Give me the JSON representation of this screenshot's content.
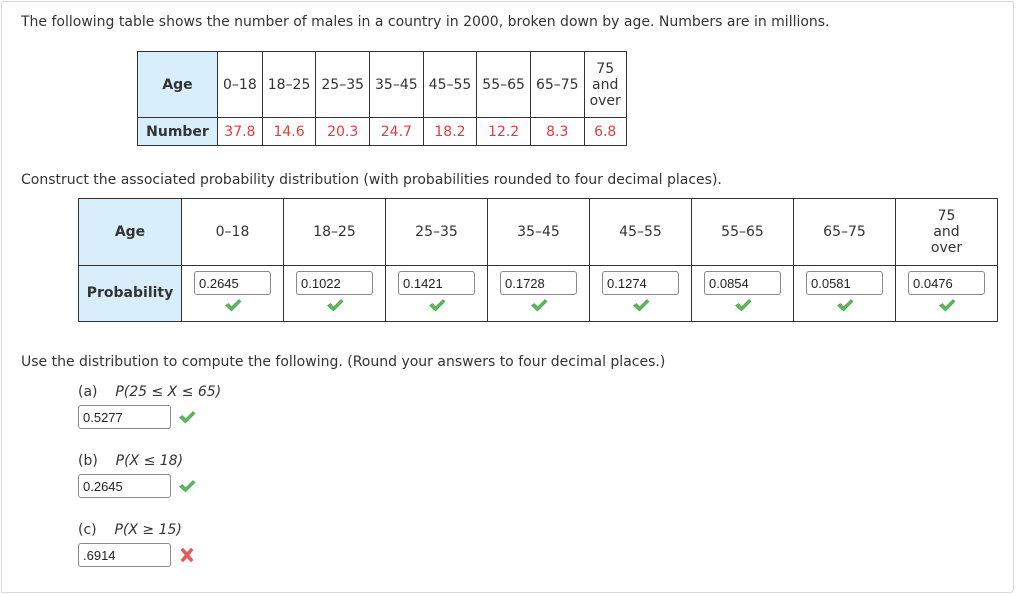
{
  "intro_text": "The following table shows the number of males in a country in 2000, broken down by age. Numbers are in millions.",
  "data_table": {
    "row_header_age": "Age",
    "row_header_number": "Number",
    "age_groups": [
      "0–18",
      "18–25",
      "25–35",
      "35–45",
      "45–55",
      "55–65",
      "65–75"
    ],
    "last_group": [
      "75",
      "and",
      "over"
    ],
    "numbers": [
      "37.8",
      "14.6",
      "20.3",
      "24.7",
      "18.2",
      "12.2",
      "8.3",
      "6.8"
    ]
  },
  "construct_text": "Construct the associated probability distribution (with probabilities rounded to four decimal places).",
  "prob_table": {
    "row_header_age": "Age",
    "row_header_prob": "Probability",
    "age_groups": [
      "0–18",
      "18–25",
      "25–35",
      "35–45",
      "45–55",
      "55–65",
      "65–75"
    ],
    "last_group": [
      "75",
      "and",
      "over"
    ],
    "answers": [
      "0.2645",
      "0.1022",
      "0.1421",
      "0.1728",
      "0.1274",
      "0.0854",
      "0.0581",
      "0.0476"
    ],
    "status": [
      "correct",
      "correct",
      "correct",
      "correct",
      "correct",
      "correct",
      "correct",
      "correct"
    ]
  },
  "use_text": "Use the distribution to compute the following. (Round your answers to four decimal places.)",
  "questions": [
    {
      "part": "(a)",
      "expr": "P(25 ≤ X ≤ 65)",
      "answer": "0.5277",
      "status": "correct"
    },
    {
      "part": "(b)",
      "expr": "P(X ≤ 18)",
      "answer": "0.2645",
      "status": "correct"
    },
    {
      "part": "(c)",
      "expr": "P(X ≥ 15)",
      "answer": ".6914",
      "status": "incorrect"
    }
  ],
  "colors": {
    "header_bg": "#d9eefb",
    "number_red": "#e23c3c",
    "check_green": "#5cb85c",
    "cross_red": "#e45b5b"
  }
}
